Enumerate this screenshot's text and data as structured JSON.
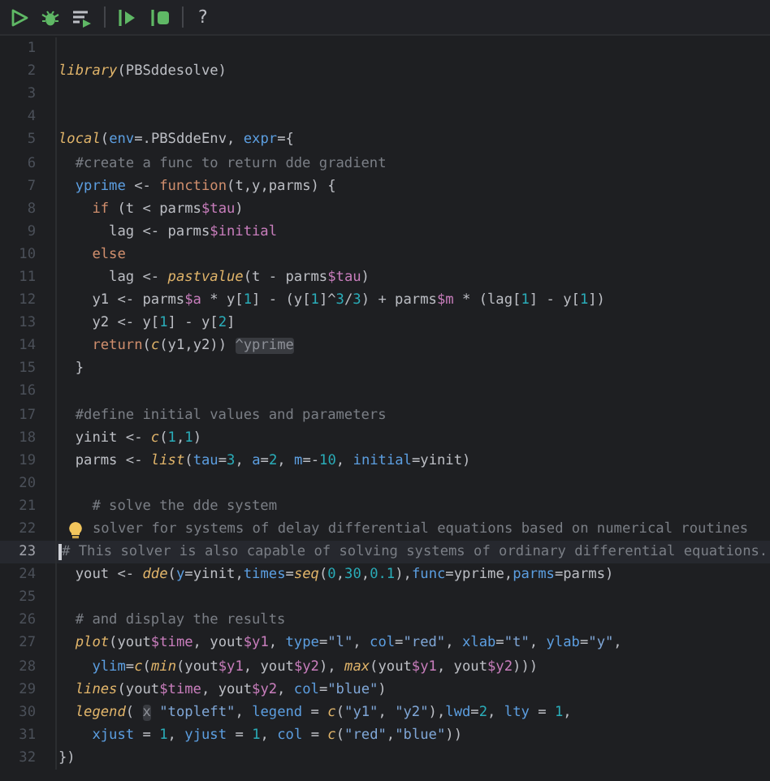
{
  "toolbar": {
    "buttons": [
      {
        "kind": "run"
      },
      {
        "kind": "debug"
      },
      {
        "kind": "run-list"
      },
      {
        "kind": "sep"
      },
      {
        "kind": "run-to"
      },
      {
        "kind": "run-step"
      },
      {
        "kind": "sep"
      },
      {
        "kind": "help",
        "label": "?"
      }
    ]
  },
  "editor": {
    "lines": [
      {
        "number": "1"
      },
      {
        "number": "2",
        "tokens": [
          {
            "kind": "fn",
            "text": "library"
          },
          {
            "kind": "p",
            "text": "(PBSddesolve)"
          }
        ]
      },
      {
        "number": "3"
      },
      {
        "number": "4"
      },
      {
        "number": "5",
        "tokens": [
          {
            "kind": "fn",
            "text": "local"
          },
          {
            "kind": "p",
            "text": "("
          },
          {
            "kind": "arg",
            "text": "env"
          },
          {
            "kind": "p",
            "text": "=.PBSddeEnv, "
          },
          {
            "kind": "arg",
            "text": "expr"
          },
          {
            "kind": "p",
            "text": "={"
          }
        ]
      },
      {
        "number": "6",
        "tokens": [
          {
            "kind": "cm",
            "text": "  #create a func to return dde gradient"
          }
        ]
      },
      {
        "number": "7",
        "tokens": [
          {
            "kind": "arg",
            "text": "  yprime"
          },
          {
            "kind": "p",
            "text": " <- "
          },
          {
            "kind": "kw",
            "text": "function"
          },
          {
            "kind": "p",
            "text": "(t,y,parms) {"
          }
        ]
      },
      {
        "number": "8",
        "tokens": [
          {
            "kind": "kw",
            "text": "    if"
          },
          {
            "kind": "p",
            "text": " (t < parms"
          },
          {
            "kind": "fld",
            "text": "$tau"
          },
          {
            "kind": "p",
            "text": ")"
          }
        ]
      },
      {
        "number": "9",
        "tokens": [
          {
            "kind": "p",
            "text": "      lag <- parms"
          },
          {
            "kind": "fld",
            "text": "$initial"
          }
        ]
      },
      {
        "number": "10",
        "tokens": [
          {
            "kind": "kw",
            "text": "    else"
          }
        ]
      },
      {
        "number": "11",
        "tokens": [
          {
            "kind": "p",
            "text": "      lag <- "
          },
          {
            "kind": "fn",
            "text": "pastvalue"
          },
          {
            "kind": "p",
            "text": "(t - parms"
          },
          {
            "kind": "fld",
            "text": "$tau"
          },
          {
            "kind": "p",
            "text": ")"
          }
        ]
      },
      {
        "number": "12",
        "tokens": [
          {
            "kind": "p",
            "text": "    y1 <- parms"
          },
          {
            "kind": "fld",
            "text": "$a"
          },
          {
            "kind": "p",
            "text": " * y["
          },
          {
            "kind": "num",
            "text": "1"
          },
          {
            "kind": "p",
            "text": "] - (y["
          },
          {
            "kind": "num",
            "text": "1"
          },
          {
            "kind": "p",
            "text": "]^"
          },
          {
            "kind": "num",
            "text": "3"
          },
          {
            "kind": "p",
            "text": "/"
          },
          {
            "kind": "num",
            "text": "3"
          },
          {
            "kind": "p",
            "text": ") + parms"
          },
          {
            "kind": "fld",
            "text": "$m"
          },
          {
            "kind": "p",
            "text": " * (lag["
          },
          {
            "kind": "num",
            "text": "1"
          },
          {
            "kind": "p",
            "text": "] - y["
          },
          {
            "kind": "num",
            "text": "1"
          },
          {
            "kind": "p",
            "text": "])"
          }
        ]
      },
      {
        "number": "13",
        "tokens": [
          {
            "kind": "p",
            "text": "    y2 <- y["
          },
          {
            "kind": "num",
            "text": "1"
          },
          {
            "kind": "p",
            "text": "] - y["
          },
          {
            "kind": "num",
            "text": "2"
          },
          {
            "kind": "p",
            "text": "]"
          }
        ]
      },
      {
        "number": "14",
        "tokens": [
          {
            "kind": "kw",
            "text": "    return"
          },
          {
            "kind": "p",
            "text": "("
          },
          {
            "kind": "fn",
            "text": "c"
          },
          {
            "kind": "p",
            "text": "(y1,y2)) "
          },
          {
            "kind": "hint",
            "text": "^yprime"
          }
        ]
      },
      {
        "number": "15",
        "tokens": [
          {
            "kind": "p",
            "text": "  }"
          }
        ]
      },
      {
        "number": "16"
      },
      {
        "number": "17",
        "tokens": [
          {
            "kind": "cm",
            "text": "  #define initial values and parameters"
          }
        ]
      },
      {
        "number": "18",
        "tokens": [
          {
            "kind": "p",
            "text": "  yinit <- "
          },
          {
            "kind": "fn",
            "text": "c"
          },
          {
            "kind": "p",
            "text": "("
          },
          {
            "kind": "num",
            "text": "1"
          },
          {
            "kind": "p",
            "text": ","
          },
          {
            "kind": "num",
            "text": "1"
          },
          {
            "kind": "p",
            "text": ")"
          }
        ]
      },
      {
        "number": "19",
        "tokens": [
          {
            "kind": "p",
            "text": "  parms <- "
          },
          {
            "kind": "fn",
            "text": "list"
          },
          {
            "kind": "p",
            "text": "("
          },
          {
            "kind": "arg",
            "text": "tau"
          },
          {
            "kind": "p",
            "text": "="
          },
          {
            "kind": "num",
            "text": "3"
          },
          {
            "kind": "p",
            "text": ", "
          },
          {
            "kind": "arg",
            "text": "a"
          },
          {
            "kind": "p",
            "text": "="
          },
          {
            "kind": "num",
            "text": "2"
          },
          {
            "kind": "p",
            "text": ", "
          },
          {
            "kind": "arg",
            "text": "m"
          },
          {
            "kind": "p",
            "text": "=-"
          },
          {
            "kind": "num",
            "text": "10"
          },
          {
            "kind": "p",
            "text": ", "
          },
          {
            "kind": "arg",
            "text": "initial"
          },
          {
            "kind": "p",
            "text": "=yinit)"
          }
        ]
      },
      {
        "number": "20"
      },
      {
        "number": "21",
        "tokens": [
          {
            "kind": "cm",
            "text": "    # solve the dde system"
          }
        ]
      },
      {
        "number": "22",
        "marker": {
          "kind": "bulb"
        },
        "tokens": [
          {
            "kind": "cm",
            "text": "solver for systems of delay differential equations based on numerical routines"
          }
        ]
      },
      {
        "number": "23",
        "current": true,
        "marker": {
          "kind": "caret"
        },
        "tokens": [
          {
            "kind": "cm",
            "text": "# This solver is also capable of solving systems of ordinary differential equations."
          }
        ]
      },
      {
        "number": "24",
        "tokens": [
          {
            "kind": "p",
            "text": "  yout <- "
          },
          {
            "kind": "fn",
            "text": "dde"
          },
          {
            "kind": "p",
            "text": "("
          },
          {
            "kind": "arg",
            "text": "y"
          },
          {
            "kind": "p",
            "text": "=yinit,"
          },
          {
            "kind": "arg",
            "text": "times"
          },
          {
            "kind": "p",
            "text": "="
          },
          {
            "kind": "fn",
            "text": "seq"
          },
          {
            "kind": "p",
            "text": "("
          },
          {
            "kind": "num",
            "text": "0"
          },
          {
            "kind": "p",
            "text": ","
          },
          {
            "kind": "num",
            "text": "30"
          },
          {
            "kind": "p",
            "text": ","
          },
          {
            "kind": "num",
            "text": "0.1"
          },
          {
            "kind": "p",
            "text": "),"
          },
          {
            "kind": "arg",
            "text": "func"
          },
          {
            "kind": "p",
            "text": "=yprime,"
          },
          {
            "kind": "arg",
            "text": "parms"
          },
          {
            "kind": "p",
            "text": "=parms)"
          }
        ]
      },
      {
        "number": "25"
      },
      {
        "number": "26",
        "tokens": [
          {
            "kind": "cm",
            "text": "  # and display the results"
          }
        ]
      },
      {
        "number": "27",
        "tokens": [
          {
            "kind": "fn",
            "text": "  plot"
          },
          {
            "kind": "p",
            "text": "(yout"
          },
          {
            "kind": "fld",
            "text": "$time"
          },
          {
            "kind": "p",
            "text": ", yout"
          },
          {
            "kind": "fld",
            "text": "$y1"
          },
          {
            "kind": "p",
            "text": ", "
          },
          {
            "kind": "arg",
            "text": "type"
          },
          {
            "kind": "p",
            "text": "="
          },
          {
            "kind": "str",
            "text": "\"l\""
          },
          {
            "kind": "p",
            "text": ", "
          },
          {
            "kind": "arg",
            "text": "col"
          },
          {
            "kind": "p",
            "text": "="
          },
          {
            "kind": "str",
            "text": "\"red\""
          },
          {
            "kind": "p",
            "text": ", "
          },
          {
            "kind": "arg",
            "text": "xlab"
          },
          {
            "kind": "p",
            "text": "="
          },
          {
            "kind": "str",
            "text": "\"t\""
          },
          {
            "kind": "p",
            "text": ", "
          },
          {
            "kind": "arg",
            "text": "ylab"
          },
          {
            "kind": "p",
            "text": "="
          },
          {
            "kind": "str",
            "text": "\"y\""
          },
          {
            "kind": "p",
            "text": ","
          }
        ]
      },
      {
        "number": "28",
        "tokens": [
          {
            "kind": "arg",
            "text": "    ylim"
          },
          {
            "kind": "p",
            "text": "="
          },
          {
            "kind": "fn",
            "text": "c"
          },
          {
            "kind": "p",
            "text": "("
          },
          {
            "kind": "fn",
            "text": "min"
          },
          {
            "kind": "p",
            "text": "(yout"
          },
          {
            "kind": "fld",
            "text": "$y1"
          },
          {
            "kind": "p",
            "text": ", yout"
          },
          {
            "kind": "fld",
            "text": "$y2"
          },
          {
            "kind": "p",
            "text": "), "
          },
          {
            "kind": "fn",
            "text": "max"
          },
          {
            "kind": "p",
            "text": "(yout"
          },
          {
            "kind": "fld",
            "text": "$y1"
          },
          {
            "kind": "p",
            "text": ", yout"
          },
          {
            "kind": "fld",
            "text": "$y2"
          },
          {
            "kind": "p",
            "text": ")))"
          }
        ]
      },
      {
        "number": "29",
        "tokens": [
          {
            "kind": "fn",
            "text": "  lines"
          },
          {
            "kind": "p",
            "text": "(yout"
          },
          {
            "kind": "fld",
            "text": "$time"
          },
          {
            "kind": "p",
            "text": ", yout"
          },
          {
            "kind": "fld",
            "text": "$y2"
          },
          {
            "kind": "p",
            "text": ", "
          },
          {
            "kind": "arg",
            "text": "col"
          },
          {
            "kind": "p",
            "text": "="
          },
          {
            "kind": "str",
            "text": "\"blue\""
          },
          {
            "kind": "p",
            "text": ")"
          }
        ]
      },
      {
        "number": "30",
        "tokens": [
          {
            "kind": "fn",
            "text": "  legend"
          },
          {
            "kind": "p",
            "text": "( "
          },
          {
            "kind": "hint",
            "text": "x"
          },
          {
            "kind": "str",
            "text": " \"topleft\""
          },
          {
            "kind": "p",
            "text": ", "
          },
          {
            "kind": "arg",
            "text": "legend"
          },
          {
            "kind": "p",
            "text": " = "
          },
          {
            "kind": "fn",
            "text": "c"
          },
          {
            "kind": "p",
            "text": "("
          },
          {
            "kind": "str",
            "text": "\"y1\""
          },
          {
            "kind": "p",
            "text": ", "
          },
          {
            "kind": "str",
            "text": "\"y2\""
          },
          {
            "kind": "p",
            "text": "),"
          },
          {
            "kind": "arg",
            "text": "lwd"
          },
          {
            "kind": "p",
            "text": "="
          },
          {
            "kind": "num",
            "text": "2"
          },
          {
            "kind": "p",
            "text": ", "
          },
          {
            "kind": "arg",
            "text": "lty"
          },
          {
            "kind": "p",
            "text": " = "
          },
          {
            "kind": "num",
            "text": "1"
          },
          {
            "kind": "p",
            "text": ","
          }
        ]
      },
      {
        "number": "31",
        "tokens": [
          {
            "kind": "arg",
            "text": "    xjust"
          },
          {
            "kind": "p",
            "text": " = "
          },
          {
            "kind": "num",
            "text": "1"
          },
          {
            "kind": "p",
            "text": ", "
          },
          {
            "kind": "arg",
            "text": "yjust"
          },
          {
            "kind": "p",
            "text": " = "
          },
          {
            "kind": "num",
            "text": "1"
          },
          {
            "kind": "p",
            "text": ", "
          },
          {
            "kind": "arg",
            "text": "col"
          },
          {
            "kind": "p",
            "text": " = "
          },
          {
            "kind": "fn",
            "text": "c"
          },
          {
            "kind": "p",
            "text": "("
          },
          {
            "kind": "str",
            "text": "\"red\""
          },
          {
            "kind": "p",
            "text": ","
          },
          {
            "kind": "str",
            "text": "\"blue\""
          },
          {
            "kind": "p",
            "text": "))"
          }
        ]
      },
      {
        "number": "32",
        "tokens": [
          {
            "kind": "p",
            "text": "})"
          }
        ]
      }
    ]
  }
}
